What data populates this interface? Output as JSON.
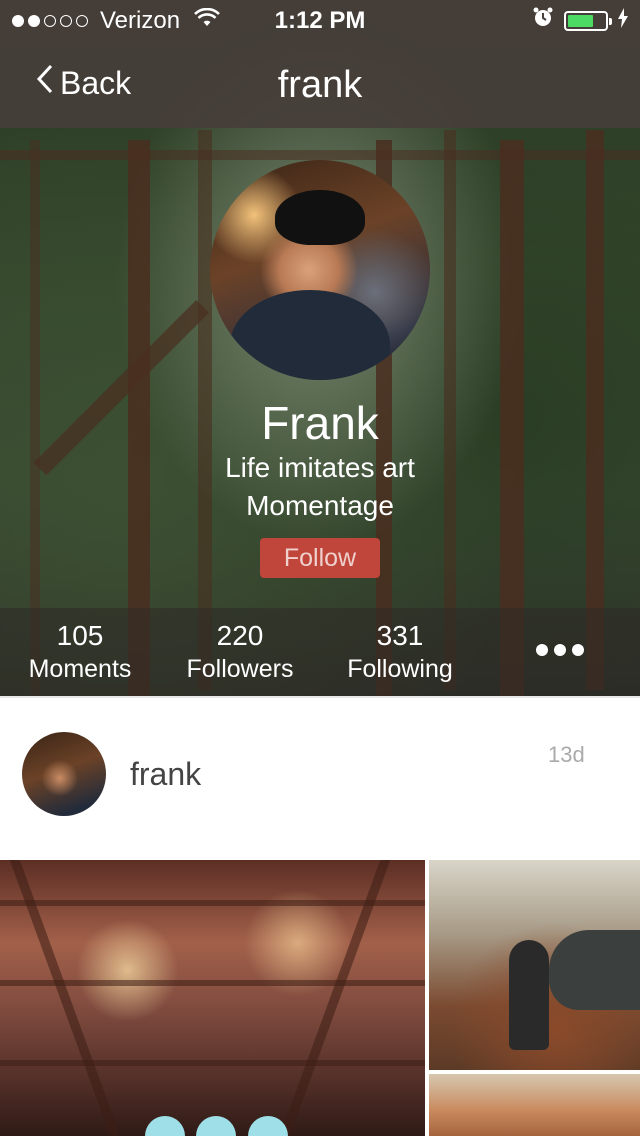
{
  "status_bar": {
    "carrier": "Verizon",
    "time": "1:12 PM",
    "signal_bars_filled": 2,
    "signal_bars_total": 5,
    "wifi_icon": "wifi-icon",
    "alarm_icon": "alarm-icon",
    "battery_level": 0.7,
    "battery_color": "#4cd964",
    "charging_icon": "bolt-icon"
  },
  "nav": {
    "back_label": "Back",
    "title": "frank"
  },
  "profile": {
    "name": "Frank",
    "bio_line1": "Life imitates art",
    "bio_line2": "Momentage",
    "follow_label": "Follow",
    "follow_color": "#c0453a"
  },
  "stats": [
    {
      "value": "105",
      "label": "Moments"
    },
    {
      "value": "220",
      "label": "Followers"
    },
    {
      "value": "331",
      "label": "Following"
    }
  ],
  "post": {
    "username": "frank",
    "time": "13d"
  }
}
